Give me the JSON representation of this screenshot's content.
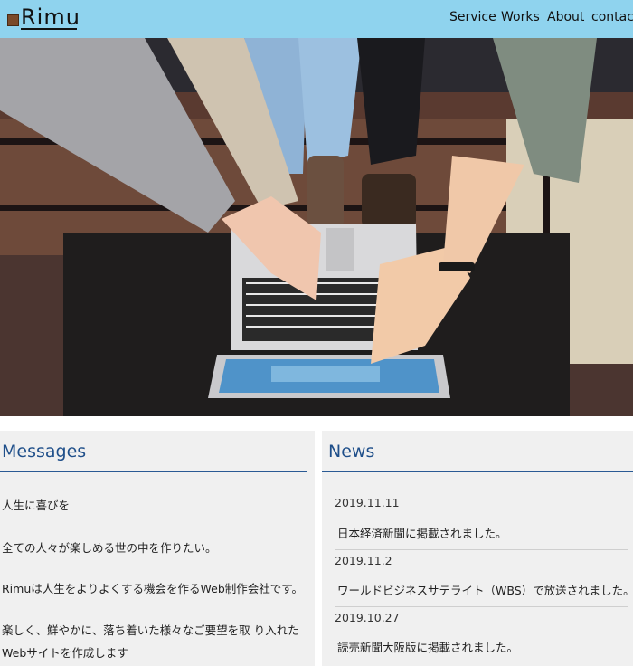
{
  "header": {
    "logo_text": "Rimu",
    "nav": [
      "Service",
      "Works",
      "About",
      "contact"
    ]
  },
  "hero": {
    "image_alt": "hands-pointing-at-laptop-photo"
  },
  "messages": {
    "title": "Messages",
    "lines": [
      "人生に喜びを",
      "全ての人々が楽しめる世の中を作りたい。",
      "Rimuは人生をよりよくする機会を作るWeb制作会社です。",
      "楽しく、鮮やかに、落ち着いた様々なご要望を取 り入れた",
      "Webサイトを作成します"
    ]
  },
  "news": {
    "title": "News",
    "items": [
      {
        "date": "2019.11.11",
        "text": "日本経済新聞に掲載されました。"
      },
      {
        "date": "2019.11.2",
        "text": "ワールドビジネスサテライト（WBS）で放送されました。"
      },
      {
        "date": "2019.10.27",
        "text": "読売新聞大阪版に掲載されました。"
      }
    ]
  },
  "colors": {
    "header_bg": "#8fd3ee",
    "accent": "#1f4f8a",
    "panel_bg": "#f0f0f0"
  }
}
